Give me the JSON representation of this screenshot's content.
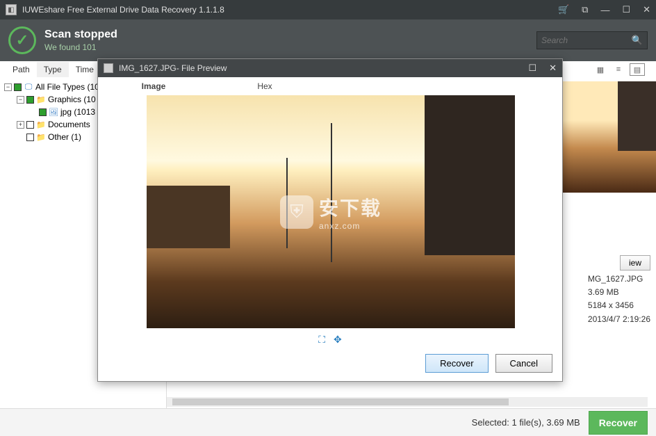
{
  "app": {
    "title": "IUWEshare Free External Drive Data Recovery 1.1.1.8"
  },
  "scan": {
    "status": "Scan stopped",
    "found": "We found 101"
  },
  "search": {
    "placeholder": "Search"
  },
  "columns": [
    "Path",
    "Type",
    "Time"
  ],
  "tree": {
    "root": "All File Types (10",
    "graphics": "Graphics (10",
    "jpg": "jpg (1013",
    "documents": "Documents",
    "other": "Other (1)"
  },
  "details": {
    "preview_btn": "iew",
    "name": "MG_1627.JPG",
    "size": "3.69 MB",
    "dims": "5184 x 3456",
    "date": "2013/4/7 2:19:26"
  },
  "statusbar": {
    "selected": "Selected: 1 file(s), 3.69 MB",
    "recover": "Recover"
  },
  "modal": {
    "title": "IMG_1627.JPG- File Preview",
    "tab_image": "Image",
    "tab_hex": "Hex",
    "recover": "Recover",
    "cancel": "Cancel",
    "watermark_main": "安下载",
    "watermark_sub": "anxz.com"
  }
}
